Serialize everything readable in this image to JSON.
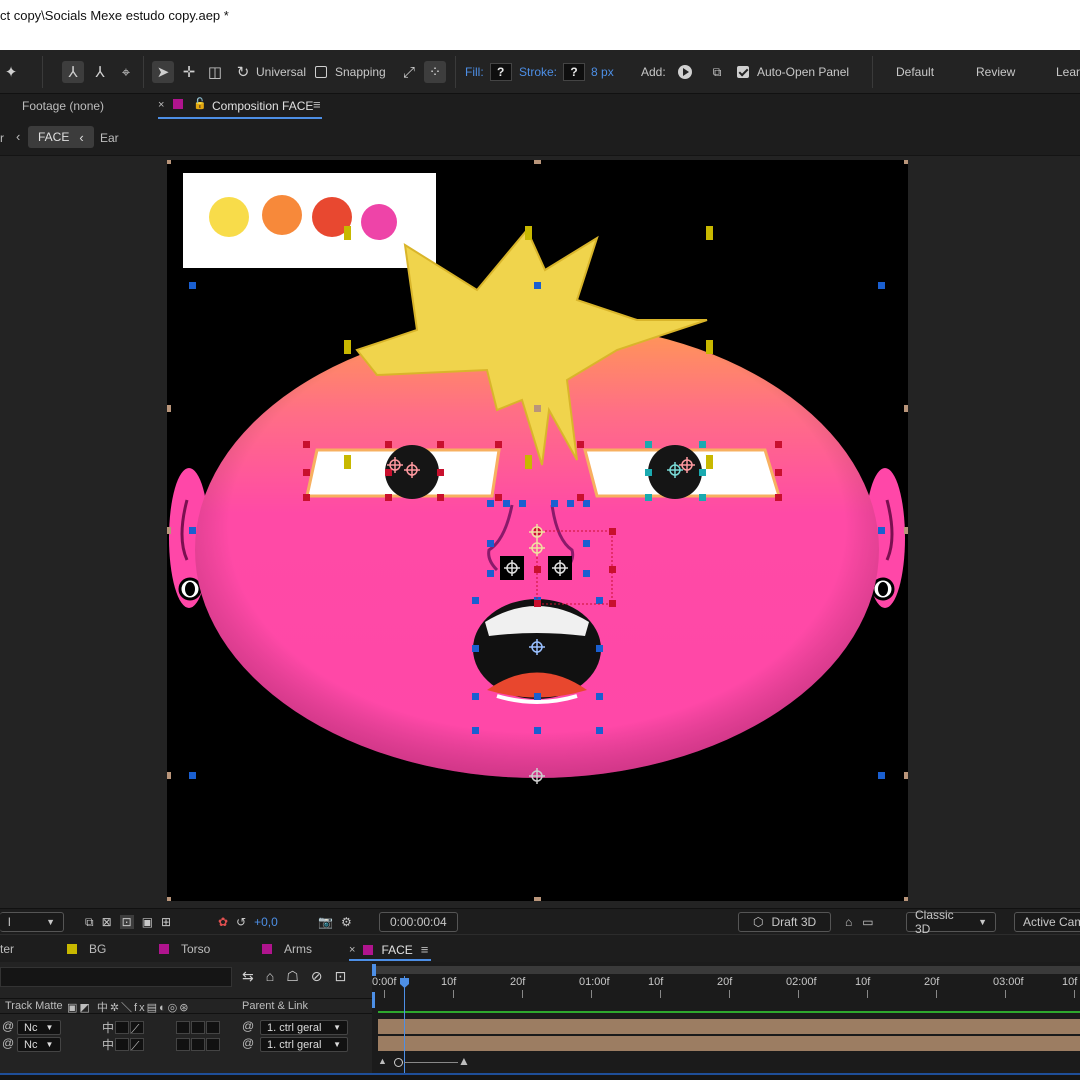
{
  "window": {
    "title": "ct copy\\Socials Mexe estudo copy.aep *"
  },
  "toolbar": {
    "universal_label": "Universal",
    "snapping_label": "Snapping",
    "fill_label": "Fill:",
    "fill_value": "?",
    "stroke_label": "Stroke:",
    "stroke_value": "?",
    "stroke_width": "8 px",
    "add_label": "Add:",
    "auto_open_label": "Auto-Open Panel",
    "workspaces": [
      "Default",
      "Review",
      "Learn"
    ]
  },
  "panels": {
    "footage_tab": "Footage (none)",
    "composition_tab": "Composition FACE",
    "nav_prev": "r",
    "nav_current": "FACE",
    "nav_next": "Ear"
  },
  "viewer_footer": {
    "zoom_value": "l",
    "exposure_value": "+0,0",
    "timecode": "0:00:00:04",
    "draft3d_label": "Draft 3D",
    "renderer": "Classic 3D",
    "camera": "Active Came"
  },
  "timeline": {
    "tabs": [
      {
        "label": "ter",
        "color": ""
      },
      {
        "label": "BG",
        "color": "#c8b800"
      },
      {
        "label": "Torso",
        "color": "#b0148e"
      },
      {
        "label": "Arms",
        "color": "#b0148e"
      },
      {
        "label": "FACE",
        "color": "#b0148e"
      }
    ],
    "columns": {
      "track_matte": "Track Matte",
      "parent_link": "Parent & Link"
    },
    "ruler": [
      "0:00f",
      "10f",
      "20f",
      "01:00f",
      "10f",
      "20f",
      "02:00f",
      "10f",
      "20f",
      "03:00f",
      "10f"
    ],
    "rows": [
      {
        "matte": "Nc",
        "parent": "1. ctrl geral"
      },
      {
        "matte": "Nc",
        "parent": "1. ctrl geral"
      }
    ]
  },
  "colors": {
    "face_pink": "#ff47a8",
    "hair_yellow": "#f0d44c",
    "accent_blue": "#4d8fe6",
    "palette": [
      "#f8dc4a",
      "#f7893a",
      "#e84830",
      "#ee44a8"
    ]
  }
}
